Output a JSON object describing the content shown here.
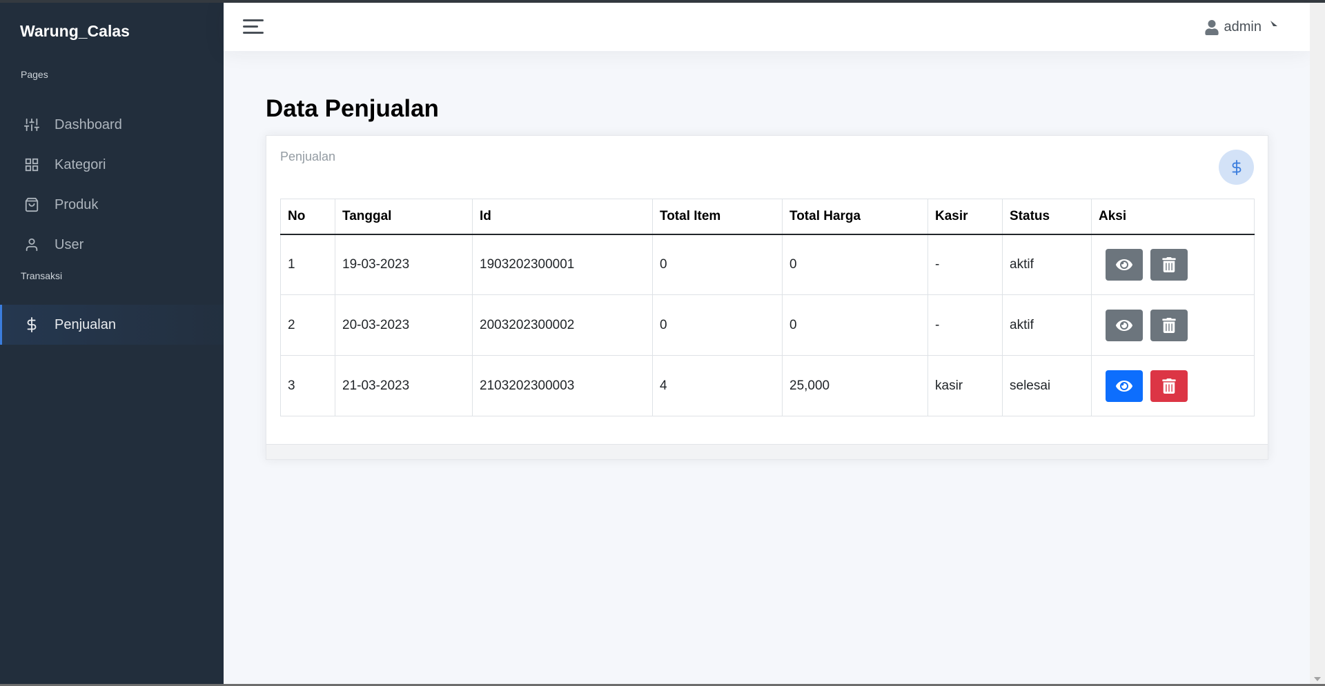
{
  "brand": "Warung_Calas",
  "sidebar": {
    "header_pages": "Pages",
    "header_transaksi": "Transaksi",
    "items": [
      {
        "label": "Dashboard",
        "icon": "sliders-icon"
      },
      {
        "label": "Kategori",
        "icon": "grid-icon"
      },
      {
        "label": "Produk",
        "icon": "shopping-bag-icon"
      },
      {
        "label": "User",
        "icon": "user-icon"
      },
      {
        "label": "Penjualan",
        "icon": "dollar-icon",
        "active": true
      }
    ]
  },
  "navbar": {
    "user_name": "admin"
  },
  "page": {
    "title_bold": "Data",
    "title_rest": "Penjualan"
  },
  "card": {
    "title": "Penjualan",
    "icon": "dollar-icon"
  },
  "table": {
    "headers": [
      "No",
      "Tanggal",
      "Id",
      "Total Item",
      "Total Harga",
      "Kasir",
      "Status",
      "Aksi"
    ],
    "rows": [
      {
        "no": "1",
        "tanggal": "19-03-2023",
        "id": "1903202300001",
        "total_item": "0",
        "total_harga": "0",
        "kasir": "-",
        "status": "aktif"
      },
      {
        "no": "2",
        "tanggal": "20-03-2023",
        "id": "2003202300002",
        "total_item": "0",
        "total_harga": "0",
        "kasir": "-",
        "status": "aktif"
      },
      {
        "no": "3",
        "tanggal": "21-03-2023",
        "id": "2103202300003",
        "total_item": "4",
        "total_harga": "25,000",
        "kasir": "kasir",
        "status": "selesai"
      }
    ]
  },
  "colors": {
    "sidebar_bg": "#222e3c",
    "accent": "#3b7ddd",
    "btn_view_active": "#0d6efd",
    "btn_delete_active": "#dc3545",
    "btn_disabled": "#6c757d"
  }
}
